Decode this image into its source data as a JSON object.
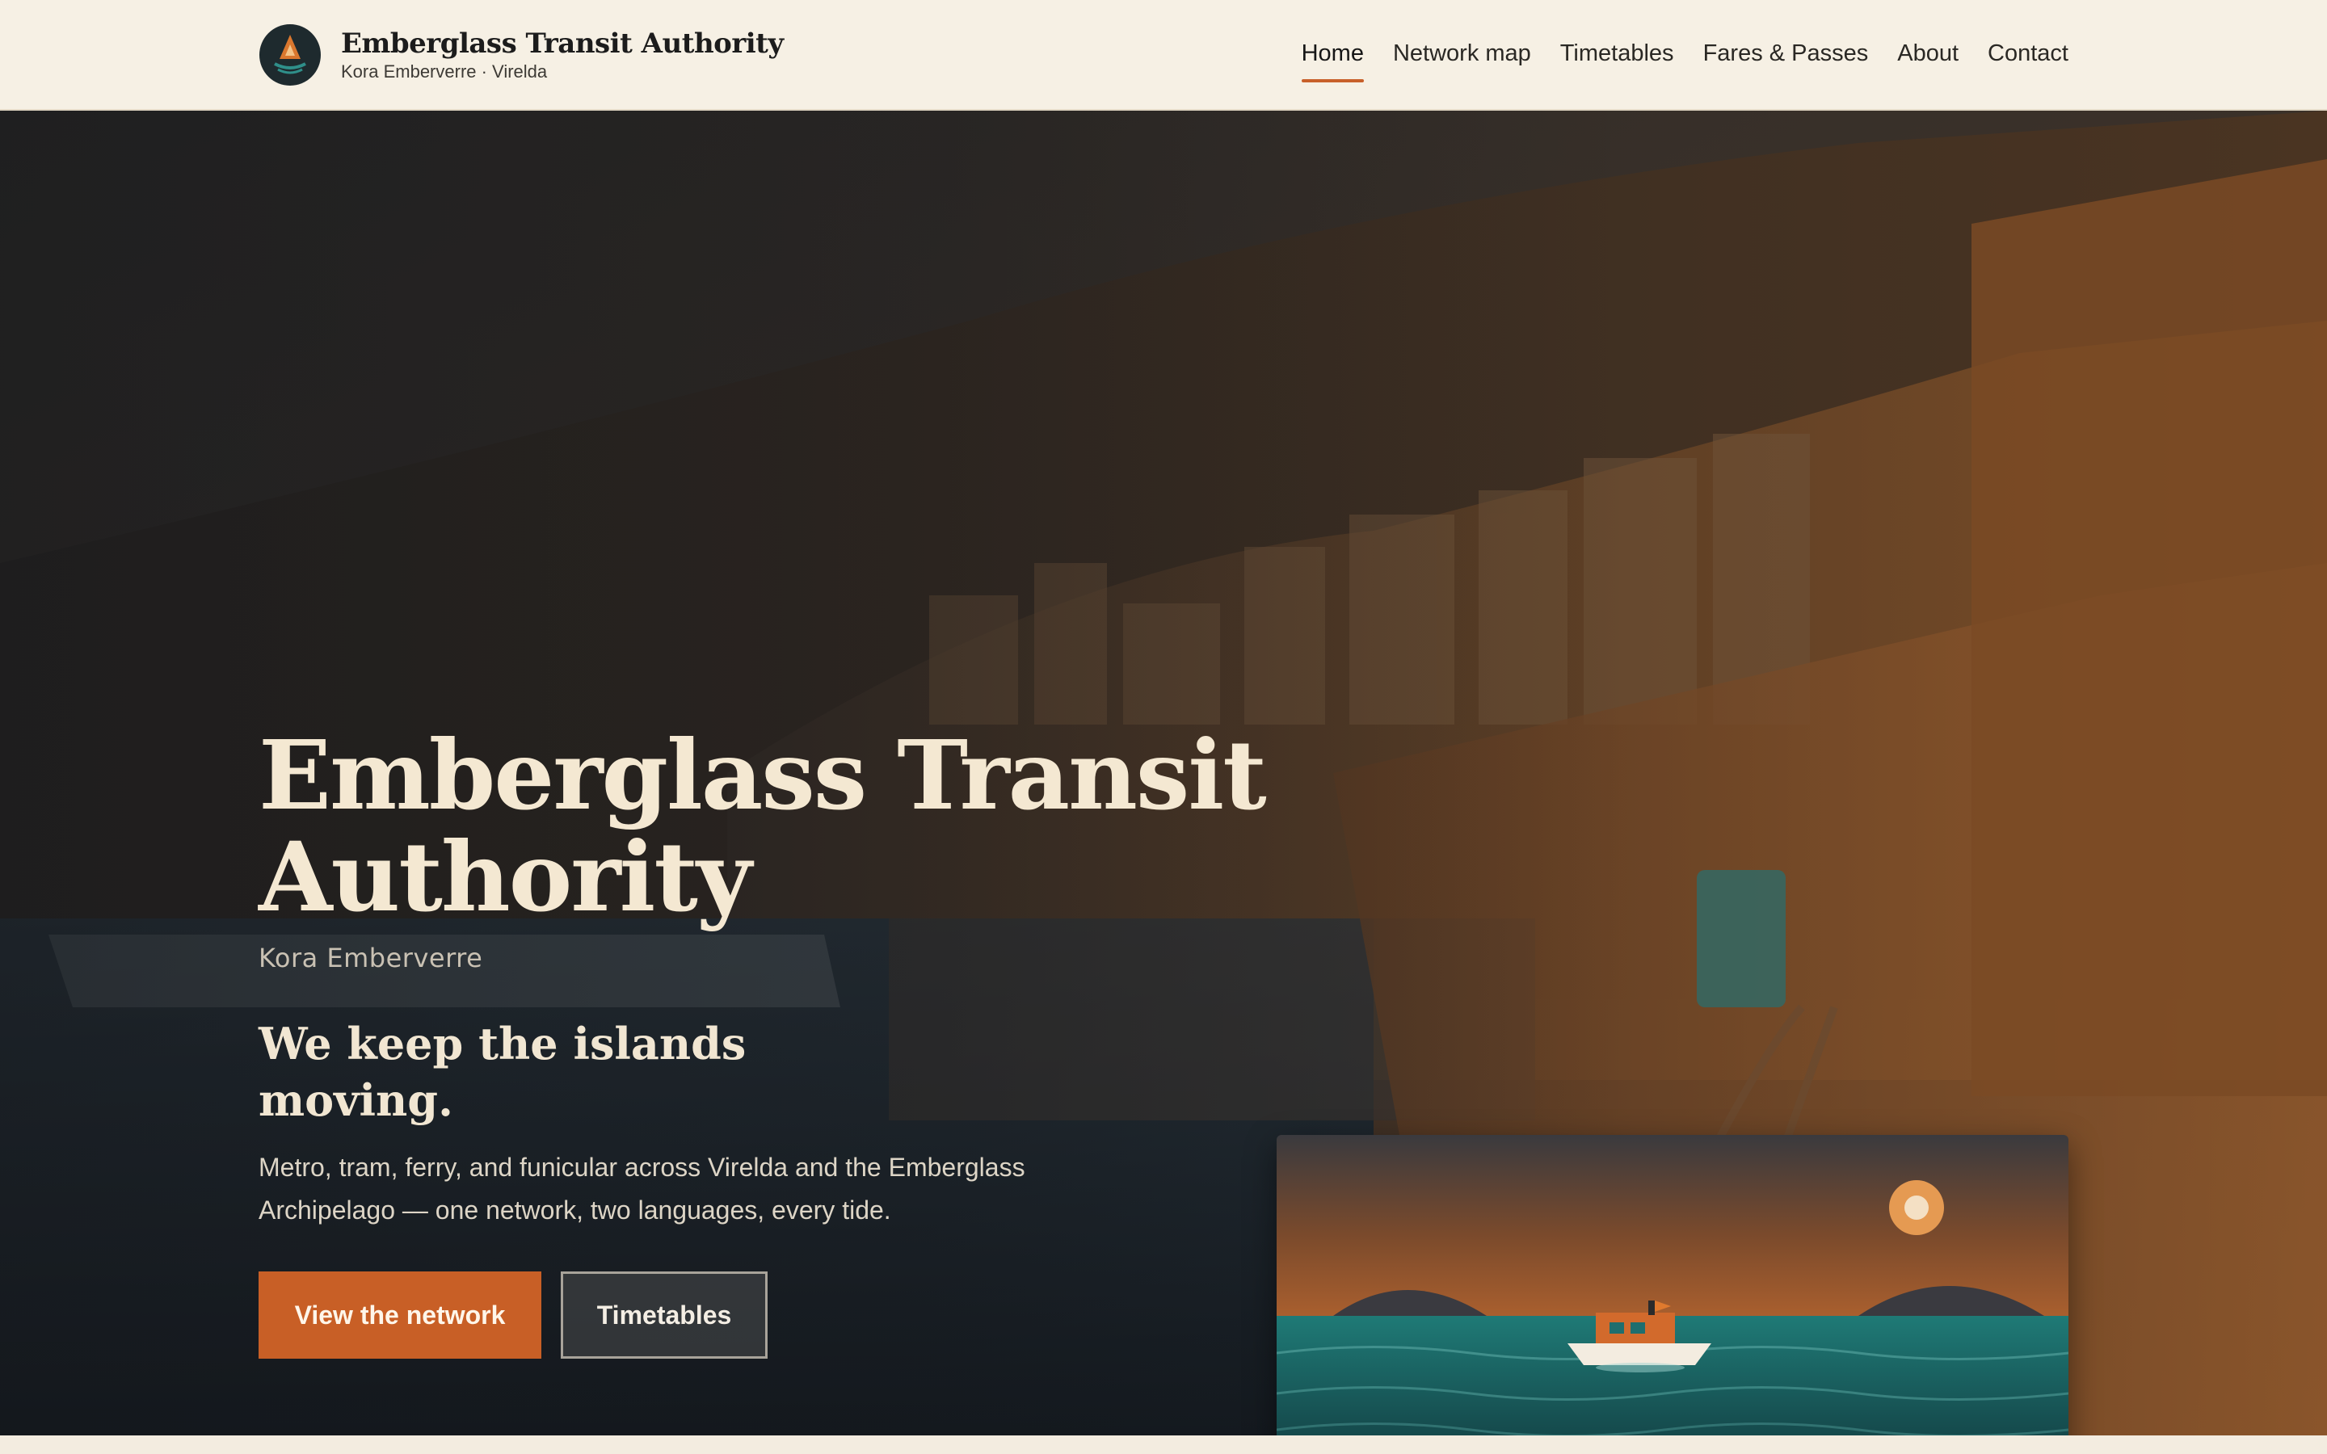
{
  "header": {
    "brand_name": "Emberglass Transit Authority",
    "brand_sub": "Kora Emberverre · Virelda",
    "logo_icon": "ember-flame-logo-icon"
  },
  "nav": {
    "items": [
      {
        "label": "Home",
        "active": true
      },
      {
        "label": "Network map",
        "active": false
      },
      {
        "label": "Timetables",
        "active": false
      },
      {
        "label": "Fares & Passes",
        "active": false
      },
      {
        "label": "About",
        "active": false
      },
      {
        "label": "Contact",
        "active": false
      }
    ]
  },
  "hero": {
    "title": "Emberglass Transit Authority",
    "subtitle": "Kora Emberverre",
    "tagline": "We keep the islands moving.",
    "description": "Metro, tram, ferry, and funicular across Virelda and the Emberglass Archipelago — one network, two languages, every tide.",
    "primary_button": "View the network",
    "secondary_button": "Timetables"
  },
  "colors": {
    "accent": "#c85f26",
    "header_bg": "#f6f0e4",
    "sea": "#1f6e6e",
    "title_text": "#f4e8d2"
  }
}
